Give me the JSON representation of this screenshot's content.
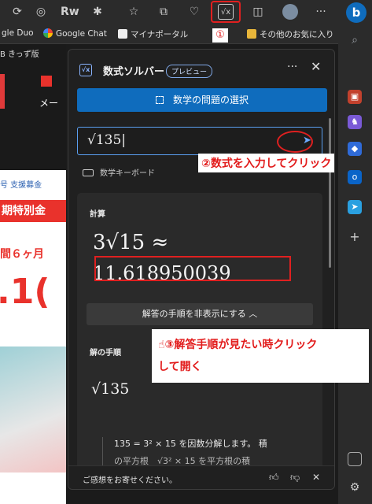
{
  "browser": {
    "toolbar_icons": [
      "refresh-icon",
      "extensions-icon",
      "rw-icon",
      "puzzle-icon",
      "favorites-star-icon",
      "collections-icon",
      "health-icon",
      "math-solver-icon",
      "tab-icon",
      "profile-avatar",
      "more-icon",
      "bing-icon"
    ],
    "more_label": "···",
    "bing_label": "b",
    "rw_label": "Rw",
    "favorites": [
      {
        "label": "gle Duo"
      },
      {
        "label": "Google Chat"
      },
      {
        "label": "マイナポータル"
      },
      {
        "label": "その他のお気に入り"
      }
    ]
  },
  "page": {
    "nav_text": "B  きっず版",
    "side_text": "メー",
    "links": "号  支援募金",
    "promo_title": "期特別金",
    "promo_sub": "間６ヶ月",
    "promo_big": ".1("
  },
  "panel": {
    "title": "数式ソルバー",
    "badge": "プレビュー",
    "more": "···",
    "close": "✕",
    "select_button": "数学の問題の選択",
    "input_value": "√135|",
    "keyboard_label": "数学キーボード",
    "calc_label": "計算",
    "result_line1": "3√15 ≈",
    "result_line2": "11.618950039",
    "toggle_label": "解答の手順を非表示にする ︿",
    "steps_label": "解の手順",
    "steps_expr": "√135",
    "step1_line1": "135 = 3² × 15 を因数分解します。 積",
    "step1_line2": "の平方根　√3² × 15 を平方根の積",
    "feedback_text": "ご感想をお寄せください。"
  },
  "annotations": {
    "num1": "①",
    "step2": "②数式を入力してクリック",
    "step3_line1": "☝③解答手順が見たい時クリック",
    "step3_line2": "して開く"
  },
  "colors": {
    "accent": "#0f6cbd",
    "annotation_red": "#e21b1b",
    "panel_bg": "#202020"
  }
}
